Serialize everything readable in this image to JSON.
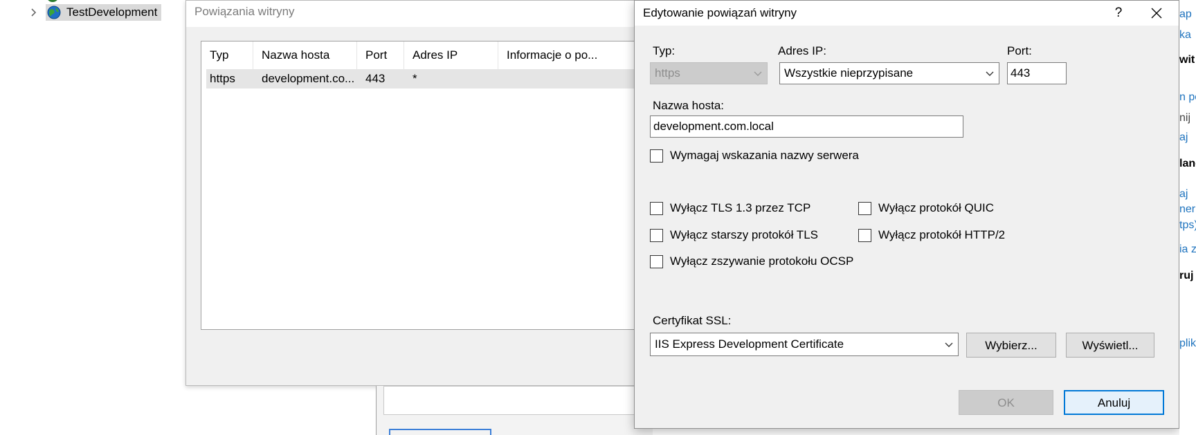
{
  "tree": {
    "node_label": "TestDevelopment"
  },
  "bindings_window": {
    "title": "Powiązania witryny",
    "columns": [
      "Typ",
      "Nazwa hosta",
      "Port",
      "Adres IP",
      "Informacje o po..."
    ],
    "rows": [
      {
        "type": "https",
        "host": "development.co...",
        "port": "443",
        "ip": "*",
        "info": ""
      }
    ]
  },
  "edit_dialog": {
    "title": "Edytowanie powiązań witryny",
    "help_glyph": "?",
    "close_glyph": "✕",
    "type_label": "Typ:",
    "type_value": "https",
    "ip_label": "Adres IP:",
    "ip_value": "Wszystkie nieprzypisane",
    "port_label": "Port:",
    "port_value": "443",
    "host_label": "Nazwa hosta:",
    "host_value": "development.com.local",
    "sni_label": "Wymagaj wskazania nazwy serwera",
    "tls13_label": "Wyłącz TLS 1.3 przez TCP",
    "quic_label": "Wyłącz protokół QUIC",
    "legacy_tls_label": "Wyłącz starszy protokół TLS",
    "http2_label": "Wyłącz protokół HTTP/2",
    "ocsp_label": "Wyłącz zszywanie protokołu OCSP",
    "ssl_label": "Certyfikat SSL:",
    "ssl_value": "IIS Express Development Certificate",
    "select_button": "Wybierz...",
    "view_button": "Wyświetl...",
    "ok_button": "OK",
    "cancel_button": "Anuluj"
  },
  "actions_pane": {
    "items": [
      "ap",
      "ka",
      "wit",
      "n po",
      "nij",
      "aj",
      "lanc",
      "aj",
      "ner",
      "tps)",
      "ia z",
      "ruj",
      "plik"
    ]
  }
}
